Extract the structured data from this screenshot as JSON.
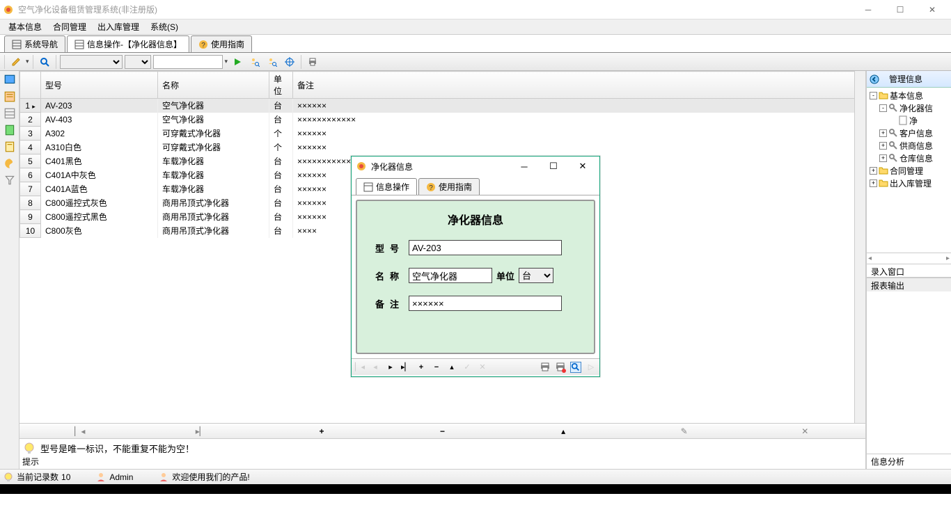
{
  "titlebar": {
    "title": "空气净化设备租赁管理系统(非注册版)"
  },
  "menu": [
    "基本信息",
    "合同管理",
    "出入库管理",
    "系统(S)"
  ],
  "tabs": [
    {
      "label": "系统导航"
    },
    {
      "label": "信息操作-【净化器信息】"
    },
    {
      "label": "使用指南"
    }
  ],
  "toolbar": {},
  "table": {
    "columns": [
      "",
      "型号",
      "名称",
      "单位",
      "备注"
    ],
    "rows": [
      {
        "n": 1,
        "model": "AV-203",
        "name": "空气净化器",
        "unit": "台",
        "remark": "××××××",
        "selected": true
      },
      {
        "n": 2,
        "model": "AV-403",
        "name": "空气净化器",
        "unit": "台",
        "remark": "××××××××××××"
      },
      {
        "n": 3,
        "model": "A302",
        "name": "可穿戴式净化器",
        "unit": "个",
        "remark": "××××××"
      },
      {
        "n": 4,
        "model": "A310白色",
        "name": "可穿戴式净化器",
        "unit": "个",
        "remark": "××××××"
      },
      {
        "n": 5,
        "model": "C401黑色",
        "name": "车载净化器",
        "unit": "台",
        "remark": "×××××××××××××××"
      },
      {
        "n": 6,
        "model": "C401A中灰色",
        "name": "车载净化器",
        "unit": "台",
        "remark": "××××××"
      },
      {
        "n": 7,
        "model": "C401A蓝色",
        "name": "车载净化器",
        "unit": "台",
        "remark": "××××××"
      },
      {
        "n": 8,
        "model": "C800遥控式灰色",
        "name": "商用吊顶式净化器",
        "unit": "台",
        "remark": "××××××"
      },
      {
        "n": 9,
        "model": "C800遥控式黑色",
        "name": "商用吊顶式净化器",
        "unit": "台",
        "remark": "××××××"
      },
      {
        "n": 10,
        "model": "C800灰色",
        "name": "商用吊顶式净化器",
        "unit": "台",
        "remark": "××××"
      }
    ]
  },
  "hint": {
    "text": "型号是唯一标识，不能重复不能为空！",
    "label": "提示"
  },
  "right": {
    "header": "管理信息",
    "tab1": "录入窗口",
    "tab2": "报表输出",
    "footer": "信息分析",
    "tree": [
      {
        "indent": 0,
        "exp": "-",
        "icon": "folder",
        "label": "基本信息"
      },
      {
        "indent": 1,
        "exp": "-",
        "icon": "key",
        "label": "净化器信"
      },
      {
        "indent": 2,
        "exp": "",
        "icon": "doc",
        "label": "净"
      },
      {
        "indent": 1,
        "exp": "+",
        "icon": "key",
        "label": "客户信息"
      },
      {
        "indent": 1,
        "exp": "+",
        "icon": "key",
        "label": "供商信息"
      },
      {
        "indent": 1,
        "exp": "+",
        "icon": "key",
        "label": "仓库信息"
      },
      {
        "indent": 0,
        "exp": "+",
        "icon": "folder",
        "label": "合同管理"
      },
      {
        "indent": 0,
        "exp": "+",
        "icon": "folder",
        "label": "出入库管理"
      }
    ]
  },
  "dialog": {
    "title": "净化器信息",
    "tab1": "信息操作",
    "tab2": "使用指南",
    "heading": "净化器信息",
    "fields": {
      "model_label": "型号",
      "model_value": "AV-203",
      "name_label": "名称",
      "name_value": "空气净化器",
      "unit_label": "单位",
      "unit_value": "台",
      "remark_label": "备注",
      "remark_value": "××××××"
    }
  },
  "status": {
    "records_label": "当前记录数",
    "records_value": "10",
    "user": "Admin",
    "welcome": "欢迎使用我们的产品!"
  }
}
